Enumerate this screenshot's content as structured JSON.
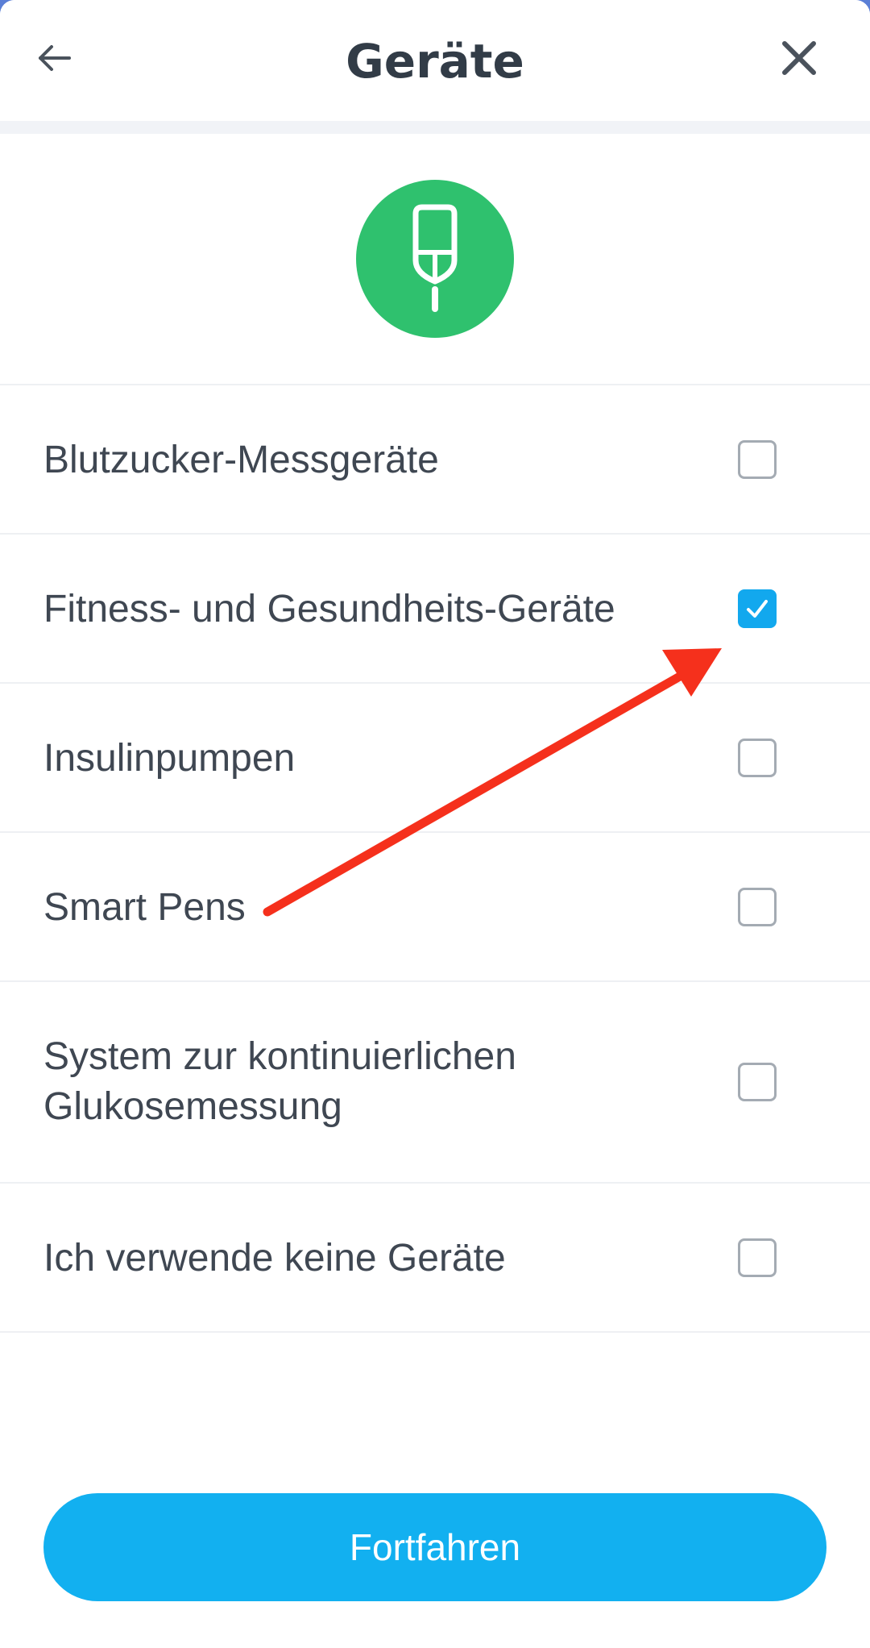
{
  "header": {
    "title": "Geräte",
    "back_icon": "arrow-left-icon",
    "close_icon": "close-icon"
  },
  "hero": {
    "icon": "glucose-meter-icon",
    "accent_color": "#2fc16e"
  },
  "devices": [
    {
      "label": "Blutzucker-Messgeräte",
      "checked": false
    },
    {
      "label": "Fitness- und Gesundheits-Geräte",
      "checked": true
    },
    {
      "label": "Insulinpumpen",
      "checked": false
    },
    {
      "label": "Smart Pens",
      "checked": false
    },
    {
      "label": "System zur kontinuierlichen Glukosemessung",
      "checked": false
    },
    {
      "label": "Ich verwende keine Geräte",
      "checked": false
    }
  ],
  "footer": {
    "continue_label": "Fortfahren"
  },
  "colors": {
    "primary": "#12b0f0",
    "checkbox_checked": "#12a8ee",
    "annotation_arrow": "#f5301c",
    "title_text": "#323c47"
  },
  "annotation": {
    "type": "arrow",
    "points_to": "Fitness- und Gesundheits-Geräte checkbox"
  }
}
